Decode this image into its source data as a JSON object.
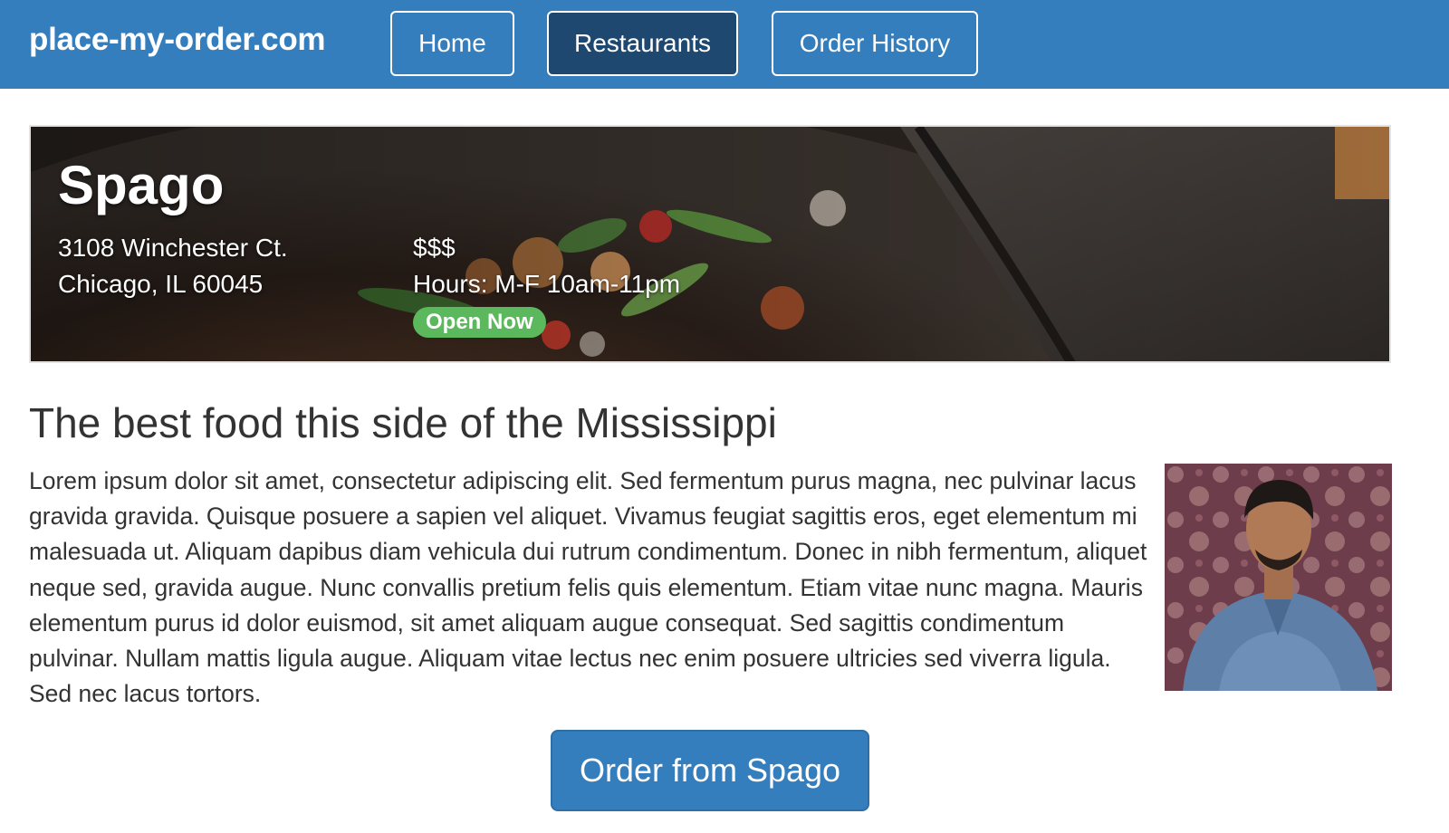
{
  "navbar": {
    "brand": "place-my-order.com",
    "items": [
      {
        "label": "Home",
        "active": false
      },
      {
        "label": "Restaurants",
        "active": true
      },
      {
        "label": "Order History",
        "active": false
      }
    ]
  },
  "restaurant": {
    "name": "Spago",
    "address_line1": "3108 Winchester Ct.",
    "address_line2": "Chicago, IL 60045",
    "price": "$$$",
    "hours": "Hours: M-F 10am-11pm",
    "status": "Open Now"
  },
  "content": {
    "heading": "The best food this side of the Mississippi",
    "paragraph": "Lorem ipsum dolor sit amet, consectetur adipiscing elit. Sed fermentum purus magna, nec pulvinar lacus gravida gravida. Quisque posuere a sapien vel aliquet. Vivamus feugiat sagittis eros, eget elementum mi malesuada ut. Aliquam dapibus diam vehicula dui rutrum condimentum. Donec in nibh fermentum, aliquet neque sed, gravida augue. Nunc convallis pretium felis quis elementum. Etiam vitae nunc magna. Mauris elementum purus id dolor euismod, sit amet aliquam augue consequat. Sed sagittis condimentum pulvinar. Nullam mattis ligula augue. Aliquam vitae lectus nec enim posuere ultricies sed viverra ligula. Sed nec lacus tortors."
  },
  "order_button": {
    "label": "Order from Spago"
  },
  "colors": {
    "navbar": "#357ebd",
    "active_nav": "#1e4870",
    "open_badge": "#5cb85c",
    "primary_button": "#357ebd"
  }
}
